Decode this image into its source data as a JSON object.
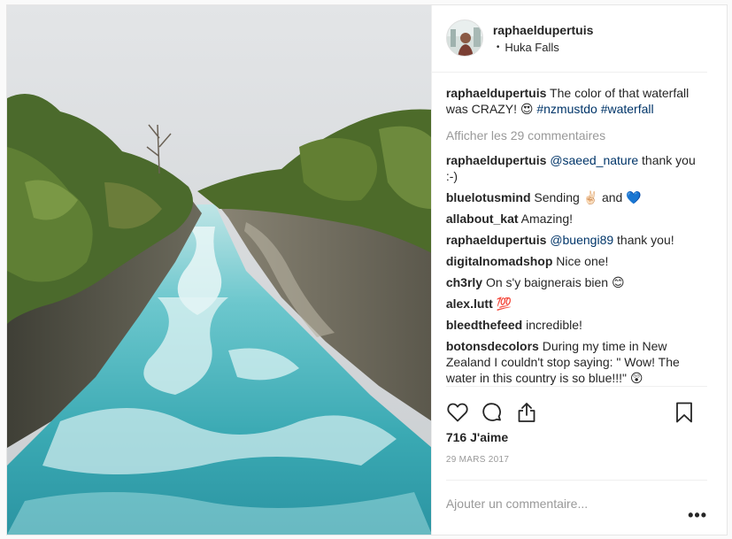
{
  "post": {
    "username": "raphaeldupertuis",
    "location": "Huka Falls",
    "location_separator": "•",
    "caption": {
      "user": "raphaeldupertuis",
      "text": " The color of that waterfall was CRAZY! 😍 ",
      "tag1": "#nzmustdo",
      "tag2": "#waterfall"
    },
    "view_more": "Afficher les 29 commentaires",
    "comments": [
      {
        "user": "raphaeldupertuis",
        "mention": "@saeed_nature",
        "text": " thank you :-)"
      },
      {
        "user": "bluelotusmind",
        "text": " Sending ✌🏻 and 💙"
      },
      {
        "user": "allabout_kat",
        "text": " Amazing!"
      },
      {
        "user": "raphaeldupertuis",
        "mention": "@buengi89",
        "text": " thank you!"
      },
      {
        "user": "digitalnomadshop",
        "text": " Nice one!"
      },
      {
        "user": "ch3rly",
        "text": " On s'y baignerais bien 😊"
      },
      {
        "user": "alex.lutt",
        "text": " 💯"
      },
      {
        "user": "bleedthefeed",
        "text": " incredible!"
      },
      {
        "user": "botonsdecolors",
        "text": " During my time in New Zealand I couldn't stop saying: \" Wow! The water in this country is so blue!!!\" 😲"
      }
    ],
    "likes": "716 J'aime",
    "date": "29 MARS 2017",
    "add_comment_placeholder": "Ajouter un commentaire...",
    "more_options": "•••"
  },
  "icons": {
    "like": "heart-icon",
    "comment": "comment-icon",
    "share": "share-icon",
    "save": "bookmark-icon",
    "options": "more-options-icon"
  },
  "colors": {
    "link": "#003569",
    "muted": "#999999",
    "text": "#262626",
    "water": "#4fb6bd"
  }
}
